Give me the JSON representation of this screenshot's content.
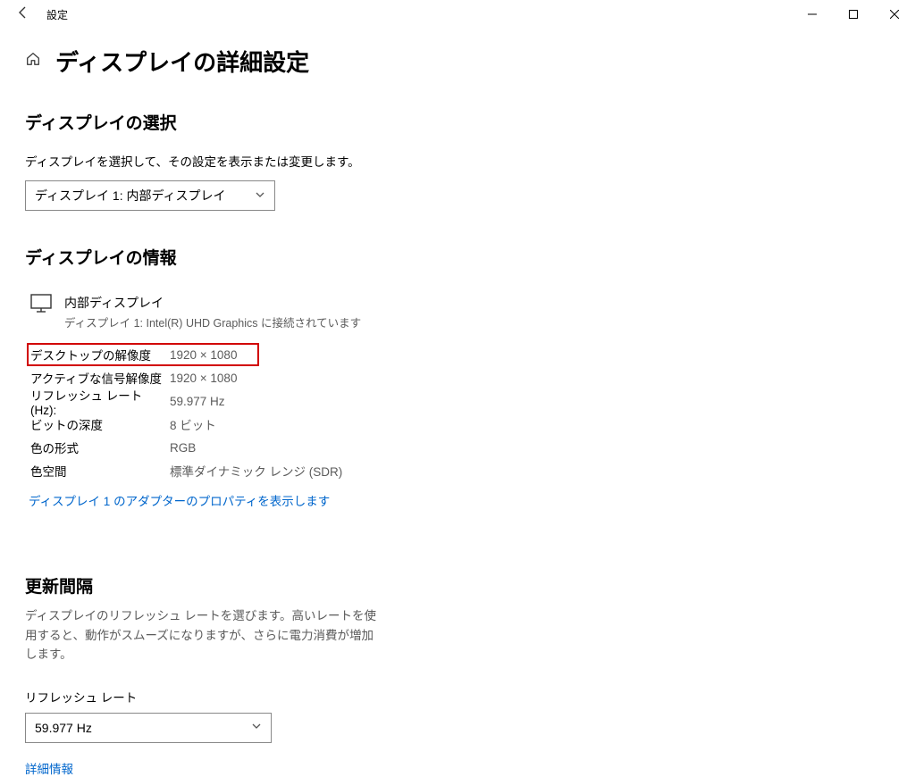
{
  "window": {
    "title": "設定"
  },
  "header": {
    "page_title": "ディスプレイの詳細設定"
  },
  "select_display": {
    "heading": "ディスプレイの選択",
    "desc": "ディスプレイを選択して、その設定を表示または変更します。",
    "dropdown_value": "ディスプレイ 1: 内部ディスプレイ"
  },
  "display_info": {
    "heading": "ディスプレイの情報",
    "name": "内部ディスプレイ",
    "sub": "ディスプレイ 1: Intel(R) UHD Graphics に接続されています",
    "rows": [
      {
        "label": "デスクトップの解像度",
        "value": "1920 × 1080"
      },
      {
        "label": "アクティブな信号解像度",
        "value": "1920 × 1080"
      },
      {
        "label": "リフレッシュ レート (Hz):",
        "value": "59.977 Hz"
      },
      {
        "label": "ビットの深度",
        "value": "8 ビット"
      },
      {
        "label": "色の形式",
        "value": "RGB"
      },
      {
        "label": "色空間",
        "value": "標準ダイナミック レンジ (SDR)"
      }
    ],
    "adapter_link": "ディスプレイ 1 のアダプターのプロパティを表示します"
  },
  "refresh": {
    "heading": "更新間隔",
    "desc": "ディスプレイのリフレッシュ レートを選びます。高いレートを使用すると、動作がスムーズになりますが、さらに電力消費が増加します。",
    "label": "リフレッシュ レート",
    "dropdown_value": "59.977 Hz",
    "more_link": "詳細情報"
  }
}
